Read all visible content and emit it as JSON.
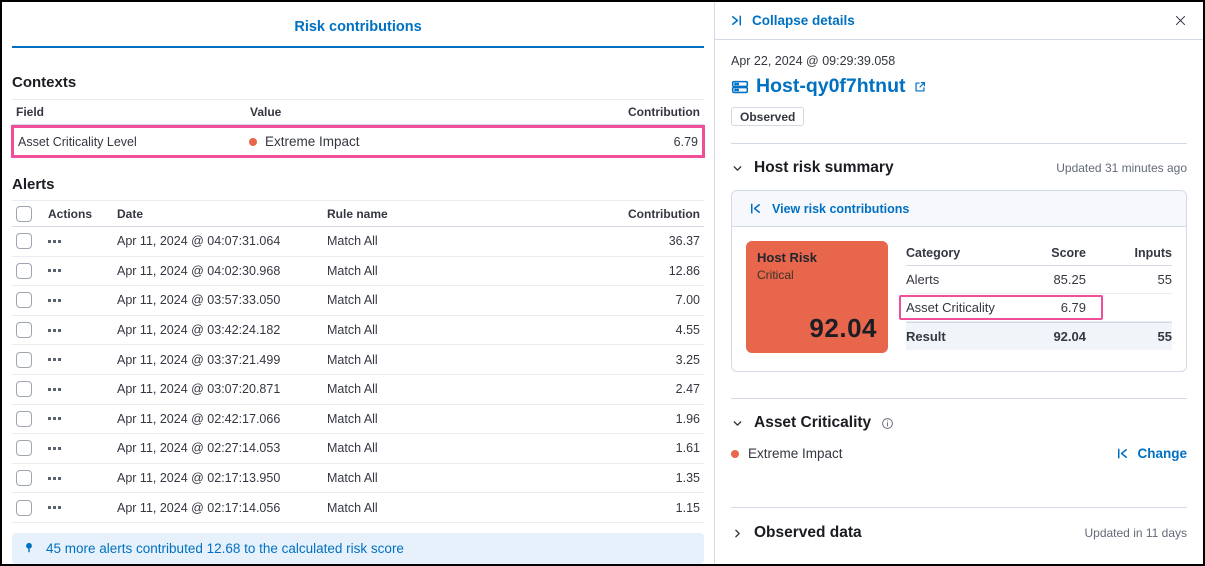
{
  "colors": {
    "link_blue": "#0071c2",
    "highlight_pink": "#f04e98",
    "risk_orange": "#e7664c",
    "callout_bg": "#e7f1fb"
  },
  "left_panel": {
    "title": "Risk contributions",
    "contexts": {
      "heading": "Contexts",
      "columns": {
        "field": "Field",
        "value": "Value",
        "contribution": "Contribution"
      },
      "row": {
        "field": "Asset Criticality Level",
        "value": "Extreme Impact",
        "contribution": "6.79"
      }
    },
    "alerts": {
      "heading": "Alerts",
      "columns": {
        "actions": "Actions",
        "date": "Date",
        "rule": "Rule name",
        "contribution": "Contribution"
      },
      "rows": [
        {
          "date": "Apr 11, 2024 @ 04:07:31.064",
          "rule": "Match All",
          "contribution": "36.37"
        },
        {
          "date": "Apr 11, 2024 @ 04:02:30.968",
          "rule": "Match All",
          "contribution": "12.86"
        },
        {
          "date": "Apr 11, 2024 @ 03:57:33.050",
          "rule": "Match All",
          "contribution": "7.00"
        },
        {
          "date": "Apr 11, 2024 @ 03:42:24.182",
          "rule": "Match All",
          "contribution": "4.55"
        },
        {
          "date": "Apr 11, 2024 @ 03:37:21.499",
          "rule": "Match All",
          "contribution": "3.25"
        },
        {
          "date": "Apr 11, 2024 @ 03:07:20.871",
          "rule": "Match All",
          "contribution": "2.47"
        },
        {
          "date": "Apr 11, 2024 @ 02:42:17.066",
          "rule": "Match All",
          "contribution": "1.96"
        },
        {
          "date": "Apr 11, 2024 @ 02:27:14.053",
          "rule": "Match All",
          "contribution": "1.61"
        },
        {
          "date": "Apr 11, 2024 @ 02:17:13.950",
          "rule": "Match All",
          "contribution": "1.35"
        },
        {
          "date": "Apr 11, 2024 @ 02:17:14.056",
          "rule": "Match All",
          "contribution": "1.15"
        }
      ],
      "footer": "45 more alerts contributed 12.68 to the calculated risk score"
    }
  },
  "details_panel": {
    "collapse_label": "Collapse details",
    "timestamp": "Apr 22, 2024 @ 09:29:39.058",
    "host_name": "Host-qy0f7htnut",
    "badge": "Observed",
    "risk_summary": {
      "heading": "Host risk summary",
      "updated": "Updated 31 minutes ago",
      "view_link": "View risk contributions",
      "card": {
        "title": "Host Risk",
        "level": "Critical",
        "score": "92.04"
      },
      "table": {
        "columns": {
          "category": "Category",
          "score": "Score",
          "inputs": "Inputs"
        },
        "rows": [
          {
            "category": "Alerts",
            "score": "85.25",
            "inputs": "55"
          },
          {
            "category": "Asset Criticality",
            "score": "6.79",
            "inputs": ""
          },
          {
            "category": "Result",
            "score": "92.04",
            "inputs": "55"
          }
        ]
      }
    },
    "asset_criticality": {
      "heading": "Asset Criticality",
      "value": "Extreme Impact",
      "change_label": "Change"
    },
    "observed_data": {
      "heading": "Observed data",
      "updated": "Updated in 11 days"
    }
  }
}
